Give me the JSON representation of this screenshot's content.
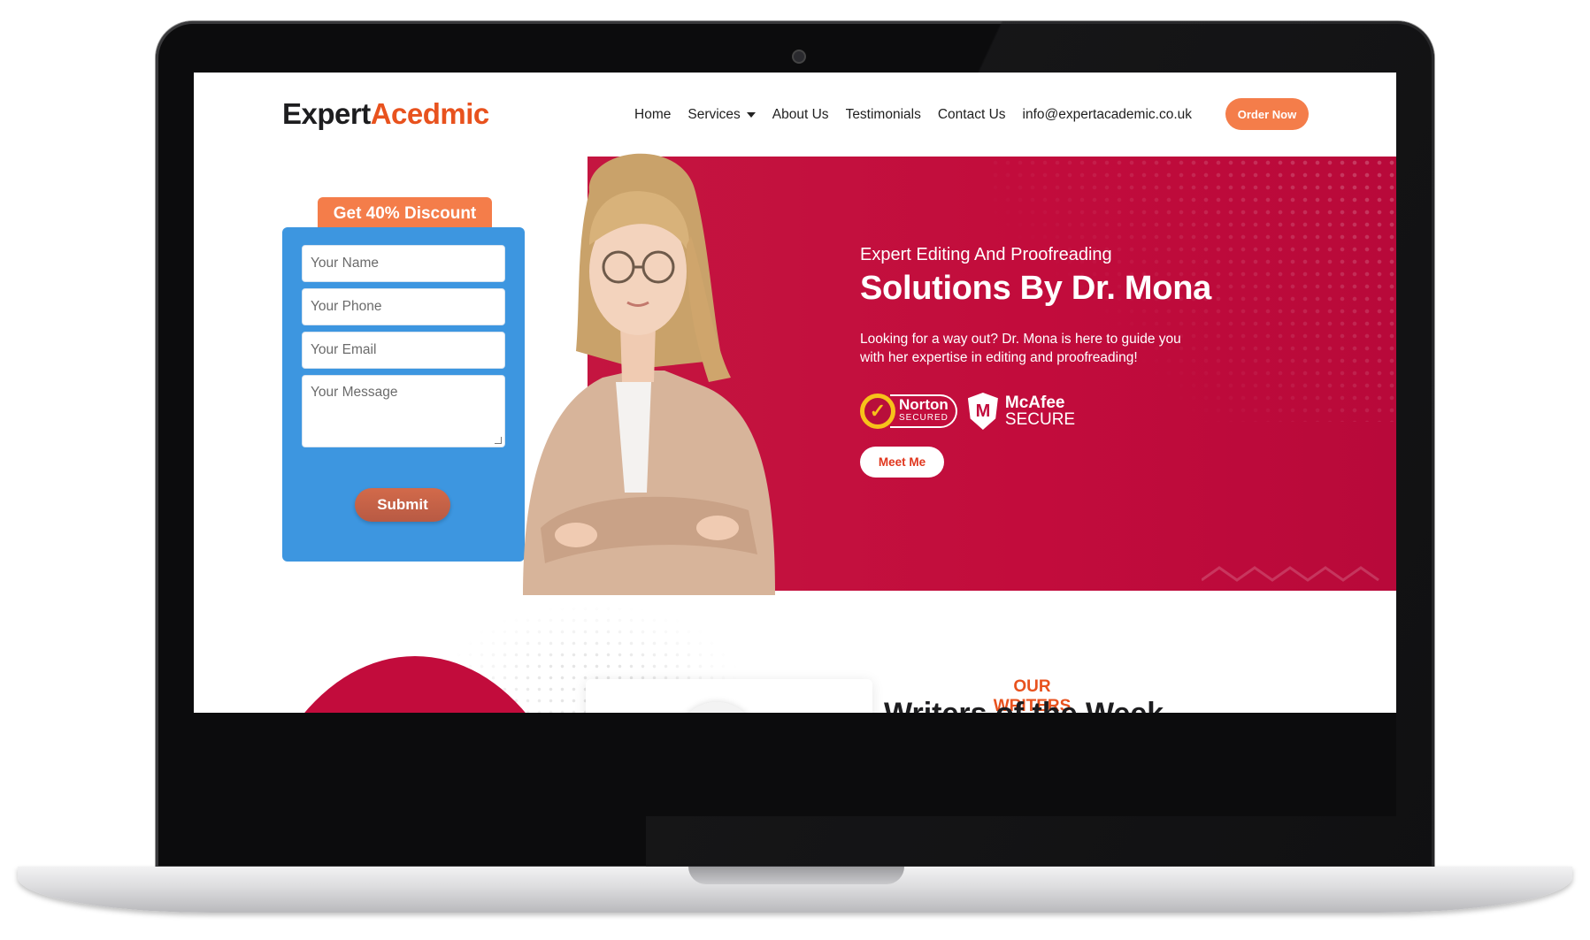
{
  "logo": {
    "part1": "Expert",
    "part2": "Acedmic"
  },
  "nav": {
    "items": [
      "Home",
      "Services",
      "About Us",
      "Testimonials",
      "Contact Us",
      "info@expertacademic.co.uk"
    ],
    "order_label": "Order Now"
  },
  "form": {
    "discount_label": "Get 40% Discount",
    "name_placeholder": "Your Name",
    "phone_placeholder": "Your Phone",
    "email_placeholder": "Your Email",
    "message_placeholder": "Your Message",
    "submit_label": "Submit"
  },
  "hero": {
    "subtitle": "Expert Editing And Proofreading",
    "title": "Solutions By Dr. Mona",
    "description": "Looking for a way out? Dr. Mona is here to guide you with her expertise in editing and proofreading!",
    "norton_name": "Norton",
    "norton_sub": "SECURED",
    "mcafee_name": "McAfee",
    "mcafee_sub": "SECURE",
    "button_label": "Meet Me"
  },
  "writers": {
    "kicker": "OUR WRITERS",
    "title": "Writers of the Week"
  },
  "colors": {
    "accent_orange": "#f47d4a",
    "hero_red": "#c20c3c",
    "form_blue": "#3d96e0"
  }
}
